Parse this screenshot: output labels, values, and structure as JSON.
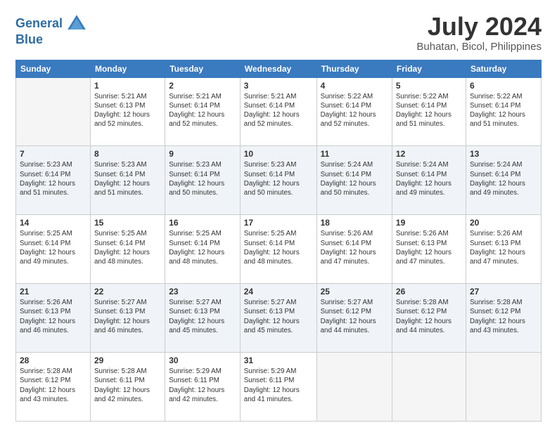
{
  "header": {
    "logo_line1": "General",
    "logo_line2": "Blue",
    "month_year": "July 2024",
    "location": "Buhatan, Bicol, Philippines"
  },
  "weekdays": [
    "Sunday",
    "Monday",
    "Tuesday",
    "Wednesday",
    "Thursday",
    "Friday",
    "Saturday"
  ],
  "weeks": [
    [
      {
        "day": "",
        "sunrise": "",
        "sunset": "",
        "daylight": ""
      },
      {
        "day": "1",
        "sunrise": "Sunrise: 5:21 AM",
        "sunset": "Sunset: 6:13 PM",
        "daylight": "Daylight: 12 hours and 52 minutes."
      },
      {
        "day": "2",
        "sunrise": "Sunrise: 5:21 AM",
        "sunset": "Sunset: 6:14 PM",
        "daylight": "Daylight: 12 hours and 52 minutes."
      },
      {
        "day": "3",
        "sunrise": "Sunrise: 5:21 AM",
        "sunset": "Sunset: 6:14 PM",
        "daylight": "Daylight: 12 hours and 52 minutes."
      },
      {
        "day": "4",
        "sunrise": "Sunrise: 5:22 AM",
        "sunset": "Sunset: 6:14 PM",
        "daylight": "Daylight: 12 hours and 52 minutes."
      },
      {
        "day": "5",
        "sunrise": "Sunrise: 5:22 AM",
        "sunset": "Sunset: 6:14 PM",
        "daylight": "Daylight: 12 hours and 51 minutes."
      },
      {
        "day": "6",
        "sunrise": "Sunrise: 5:22 AM",
        "sunset": "Sunset: 6:14 PM",
        "daylight": "Daylight: 12 hours and 51 minutes."
      }
    ],
    [
      {
        "day": "7",
        "sunrise": "Sunrise: 5:23 AM",
        "sunset": "Sunset: 6:14 PM",
        "daylight": "Daylight: 12 hours and 51 minutes."
      },
      {
        "day": "8",
        "sunrise": "Sunrise: 5:23 AM",
        "sunset": "Sunset: 6:14 PM",
        "daylight": "Daylight: 12 hours and 51 minutes."
      },
      {
        "day": "9",
        "sunrise": "Sunrise: 5:23 AM",
        "sunset": "Sunset: 6:14 PM",
        "daylight": "Daylight: 12 hours and 50 minutes."
      },
      {
        "day": "10",
        "sunrise": "Sunrise: 5:23 AM",
        "sunset": "Sunset: 6:14 PM",
        "daylight": "Daylight: 12 hours and 50 minutes."
      },
      {
        "day": "11",
        "sunrise": "Sunrise: 5:24 AM",
        "sunset": "Sunset: 6:14 PM",
        "daylight": "Daylight: 12 hours and 50 minutes."
      },
      {
        "day": "12",
        "sunrise": "Sunrise: 5:24 AM",
        "sunset": "Sunset: 6:14 PM",
        "daylight": "Daylight: 12 hours and 49 minutes."
      },
      {
        "day": "13",
        "sunrise": "Sunrise: 5:24 AM",
        "sunset": "Sunset: 6:14 PM",
        "daylight": "Daylight: 12 hours and 49 minutes."
      }
    ],
    [
      {
        "day": "14",
        "sunrise": "Sunrise: 5:25 AM",
        "sunset": "Sunset: 6:14 PM",
        "daylight": "Daylight: 12 hours and 49 minutes."
      },
      {
        "day": "15",
        "sunrise": "Sunrise: 5:25 AM",
        "sunset": "Sunset: 6:14 PM",
        "daylight": "Daylight: 12 hours and 48 minutes."
      },
      {
        "day": "16",
        "sunrise": "Sunrise: 5:25 AM",
        "sunset": "Sunset: 6:14 PM",
        "daylight": "Daylight: 12 hours and 48 minutes."
      },
      {
        "day": "17",
        "sunrise": "Sunrise: 5:25 AM",
        "sunset": "Sunset: 6:14 PM",
        "daylight": "Daylight: 12 hours and 48 minutes."
      },
      {
        "day": "18",
        "sunrise": "Sunrise: 5:26 AM",
        "sunset": "Sunset: 6:14 PM",
        "daylight": "Daylight: 12 hours and 47 minutes."
      },
      {
        "day": "19",
        "sunrise": "Sunrise: 5:26 AM",
        "sunset": "Sunset: 6:13 PM",
        "daylight": "Daylight: 12 hours and 47 minutes."
      },
      {
        "day": "20",
        "sunrise": "Sunrise: 5:26 AM",
        "sunset": "Sunset: 6:13 PM",
        "daylight": "Daylight: 12 hours and 47 minutes."
      }
    ],
    [
      {
        "day": "21",
        "sunrise": "Sunrise: 5:26 AM",
        "sunset": "Sunset: 6:13 PM",
        "daylight": "Daylight: 12 hours and 46 minutes."
      },
      {
        "day": "22",
        "sunrise": "Sunrise: 5:27 AM",
        "sunset": "Sunset: 6:13 PM",
        "daylight": "Daylight: 12 hours and 46 minutes."
      },
      {
        "day": "23",
        "sunrise": "Sunrise: 5:27 AM",
        "sunset": "Sunset: 6:13 PM",
        "daylight": "Daylight: 12 hours and 45 minutes."
      },
      {
        "day": "24",
        "sunrise": "Sunrise: 5:27 AM",
        "sunset": "Sunset: 6:13 PM",
        "daylight": "Daylight: 12 hours and 45 minutes."
      },
      {
        "day": "25",
        "sunrise": "Sunrise: 5:27 AM",
        "sunset": "Sunset: 6:12 PM",
        "daylight": "Daylight: 12 hours and 44 minutes."
      },
      {
        "day": "26",
        "sunrise": "Sunrise: 5:28 AM",
        "sunset": "Sunset: 6:12 PM",
        "daylight": "Daylight: 12 hours and 44 minutes."
      },
      {
        "day": "27",
        "sunrise": "Sunrise: 5:28 AM",
        "sunset": "Sunset: 6:12 PM",
        "daylight": "Daylight: 12 hours and 43 minutes."
      }
    ],
    [
      {
        "day": "28",
        "sunrise": "Sunrise: 5:28 AM",
        "sunset": "Sunset: 6:12 PM",
        "daylight": "Daylight: 12 hours and 43 minutes."
      },
      {
        "day": "29",
        "sunrise": "Sunrise: 5:28 AM",
        "sunset": "Sunset: 6:11 PM",
        "daylight": "Daylight: 12 hours and 42 minutes."
      },
      {
        "day": "30",
        "sunrise": "Sunrise: 5:29 AM",
        "sunset": "Sunset: 6:11 PM",
        "daylight": "Daylight: 12 hours and 42 minutes."
      },
      {
        "day": "31",
        "sunrise": "Sunrise: 5:29 AM",
        "sunset": "Sunset: 6:11 PM",
        "daylight": "Daylight: 12 hours and 41 minutes."
      },
      {
        "day": "",
        "sunrise": "",
        "sunset": "",
        "daylight": ""
      },
      {
        "day": "",
        "sunrise": "",
        "sunset": "",
        "daylight": ""
      },
      {
        "day": "",
        "sunrise": "",
        "sunset": "",
        "daylight": ""
      }
    ]
  ]
}
